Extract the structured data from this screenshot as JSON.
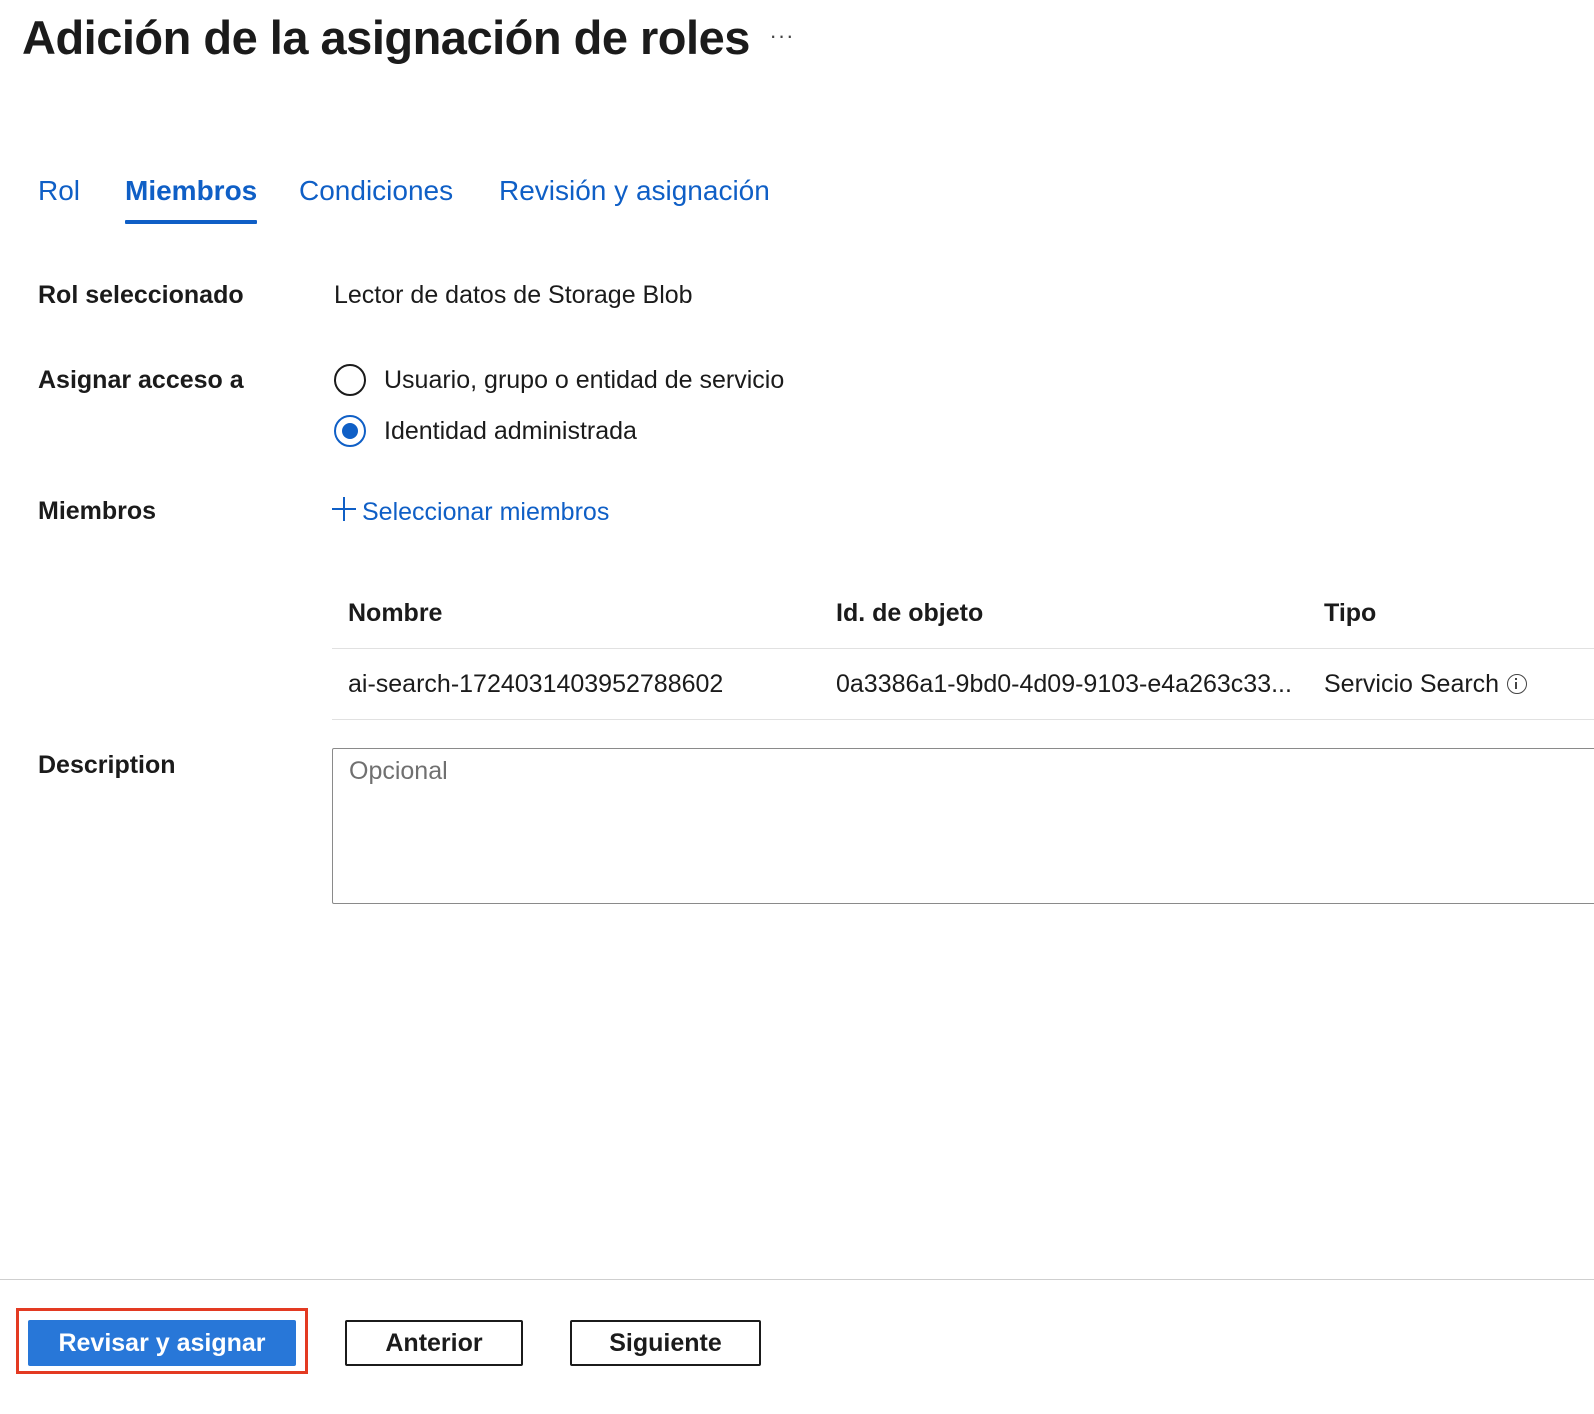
{
  "header": {
    "title": "Adición de la asignación de roles",
    "more_label": "···"
  },
  "tabs": [
    {
      "label": "Rol",
      "active": false
    },
    {
      "label": "Miembros",
      "active": true
    },
    {
      "label": "Condiciones",
      "active": false
    },
    {
      "label": "Revisión y asignación",
      "active": false
    }
  ],
  "form": {
    "selected_role": {
      "label": "Rol seleccionado",
      "value": "Lector de datos de Storage Blob"
    },
    "assign_access": {
      "label": "Asignar acceso a",
      "options": [
        {
          "label": "Usuario, grupo o entidad de servicio",
          "selected": false
        },
        {
          "label": "Identidad administrada",
          "selected": true
        }
      ]
    },
    "members": {
      "label": "Miembros",
      "select_link": "Seleccionar miembros"
    },
    "description": {
      "label": "Description",
      "placeholder": "Opcional",
      "value": ""
    }
  },
  "members_table": {
    "columns": [
      "Nombre",
      "Id. de objeto",
      "Tipo"
    ],
    "rows": [
      {
        "name": "ai-search-1724031403952788602",
        "object_id": "0a3386a1-9bd0-4d09-9103-e4a263c33...",
        "type": "Servicio Search"
      }
    ]
  },
  "footer": {
    "primary_label": "Revisar y asignar",
    "previous_label": "Anterior",
    "next_label": "Siguiente"
  },
  "colors": {
    "accent": "#0f5fc6",
    "primary_button": "#2877d8",
    "highlight": "#e33a22"
  },
  "icons": {
    "more": "ellipsis-icon",
    "add": "plus-icon",
    "info": "info-icon"
  }
}
